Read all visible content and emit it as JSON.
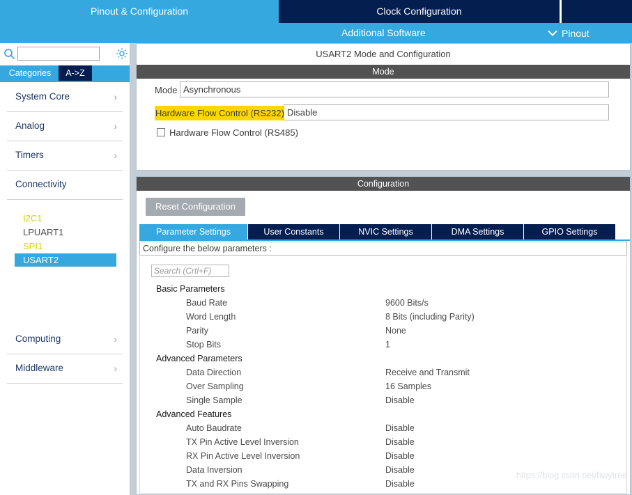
{
  "topbar": {
    "tabs": [
      {
        "label": "Pinout & Configuration",
        "active": true
      },
      {
        "label": "Clock Configuration",
        "active": false
      },
      {
        "label": "",
        "active": false
      }
    ],
    "additional_software": "Additional Software",
    "pinout_dropdown": "Pinout",
    "chevron_icon": "chevron-down-icon",
    "accent_color": "#35a8df",
    "navy_color": "#041e50"
  },
  "sidebar": {
    "search": {
      "value": "",
      "placeholder": ""
    },
    "search_icon": "search-icon",
    "gear_icon": "gear-icon",
    "tabs": [
      {
        "label": "Categories",
        "active": true
      },
      {
        "label": "A->Z",
        "active": false
      }
    ],
    "categories": [
      {
        "label": "System Core",
        "chevron": true
      },
      {
        "label": "Analog",
        "chevron": true
      },
      {
        "label": "Timers",
        "chevron": true
      },
      {
        "label": "Connectivity",
        "chevron": false
      }
    ],
    "peripherals": [
      {
        "label": "I2C1",
        "state": "warn"
      },
      {
        "label": "LPUART1",
        "state": "plain"
      },
      {
        "label": "SPI1",
        "state": "warn"
      },
      {
        "label": "USART2",
        "state": "active"
      }
    ],
    "categories_after": [
      {
        "label": "Computing",
        "chevron": true
      },
      {
        "label": "Middleware",
        "chevron": true
      }
    ],
    "warn_color": "#d2d200",
    "selected_color": "#35a8df"
  },
  "main": {
    "panel_title": "USART2 Mode and Configuration",
    "mode_section": {
      "bar_label": "Mode",
      "mode_label": "Mode",
      "mode_value": "Asynchronous",
      "hfc_rs232_label": "Hardware Flow Control (RS232)",
      "hfc_rs232_value": "Disable",
      "hfc_rs232_highlight": "#ffd700",
      "hfc_rs485_label": "Hardware Flow Control (RS485)",
      "hfc_rs485_checked": false
    },
    "config_section": {
      "bar_label": "Configuration",
      "reset_button": "Reset Configuration",
      "tabs": [
        {
          "label": "Parameter Settings",
          "active": true
        },
        {
          "label": "User Constants",
          "active": false
        },
        {
          "label": "NVIC Settings",
          "active": false
        },
        {
          "label": "DMA Settings",
          "active": false
        },
        {
          "label": "GPIO Settings",
          "active": false
        }
      ],
      "configure_hint": "Configure the below parameters :",
      "param_search_placeholder": "Search (Crtl+F)",
      "param_search_value": "",
      "parameters": [
        {
          "type": "group",
          "name": "Basic Parameters",
          "value": ""
        },
        {
          "type": "child",
          "name": "Baud Rate",
          "value": "9600 Bits/s"
        },
        {
          "type": "child",
          "name": "Word Length",
          "value": "8 Bits (including Parity)"
        },
        {
          "type": "child",
          "name": "Parity",
          "value": "None"
        },
        {
          "type": "child",
          "name": "Stop Bits",
          "value": "1"
        },
        {
          "type": "group",
          "name": "Advanced Parameters",
          "value": ""
        },
        {
          "type": "child",
          "name": "Data Direction",
          "value": "Receive and Transmit"
        },
        {
          "type": "child",
          "name": "Over Sampling",
          "value": "16 Samples"
        },
        {
          "type": "child",
          "name": "Single Sample",
          "value": "Disable"
        },
        {
          "type": "group",
          "name": "Advanced Features",
          "value": ""
        },
        {
          "type": "child",
          "name": "Auto Baudrate",
          "value": "Disable"
        },
        {
          "type": "child",
          "name": "TX Pin Active Level Inversion",
          "value": "Disable"
        },
        {
          "type": "child",
          "name": "RX Pin Active Level Inversion",
          "value": "Disable"
        },
        {
          "type": "child",
          "name": "Data Inversion",
          "value": "Disable"
        },
        {
          "type": "child",
          "name": "TX and RX Pins Swapping",
          "value": "Disable"
        }
      ]
    }
  },
  "watermark": "https://blog.csdn.net/hwytree"
}
